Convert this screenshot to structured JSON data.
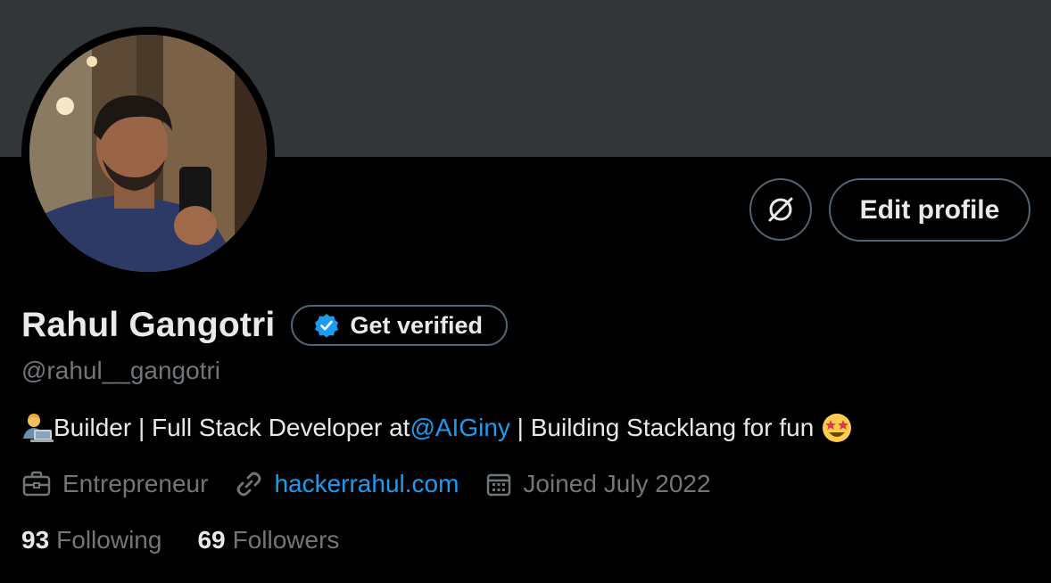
{
  "profile": {
    "name": "Rahul Gangotri",
    "handle": "@rahul__gangotri",
    "get_verified_label": "Get verified",
    "edit_profile_label": "Edit profile",
    "bio": {
      "prefix_emoji": "technologist-emoji",
      "text_before": "Builder | Full Stack Developer at ",
      "mention": "@AIGiny",
      "text_after": " | Building Stacklang for fun ",
      "suffix_emoji": "star-struck-emoji"
    },
    "profession": "Entrepreneur",
    "website": "hackerrahul.com",
    "joined": "Joined July 2022",
    "following_count": "93",
    "following_label": "Following",
    "followers_count": "69",
    "followers_label": "Followers"
  },
  "icons": {
    "extra_button": "slashed-circle-icon",
    "verified_badge": "verified-badge-icon",
    "profession": "briefcase-icon",
    "website": "link-icon",
    "joined": "calendar-icon"
  },
  "colors": {
    "background": "#000000",
    "banner": "#333639",
    "text_primary": "#e7e9ea",
    "text_secondary": "#71767b",
    "accent": "#1d9bf0",
    "border": "#536471"
  }
}
